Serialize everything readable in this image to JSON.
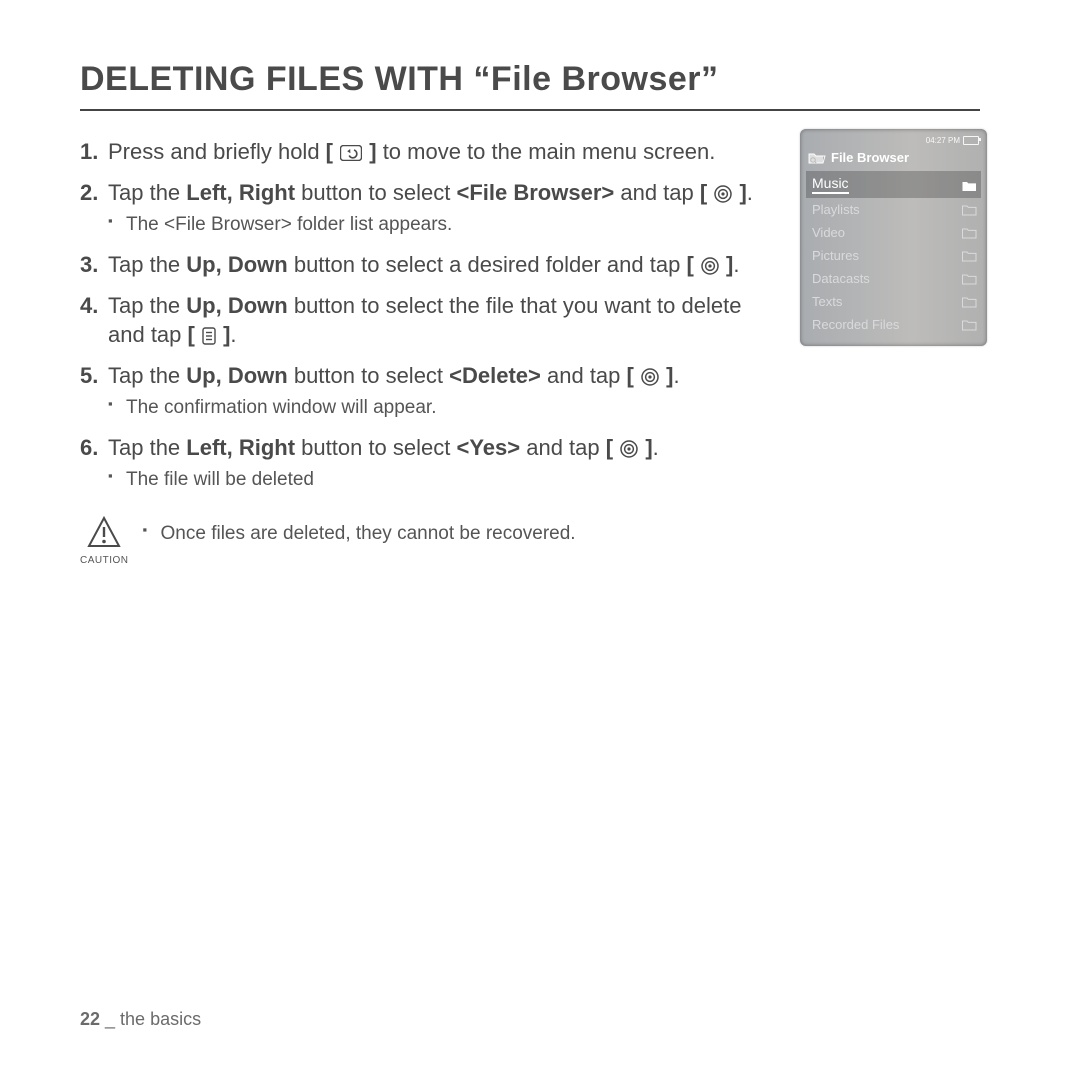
{
  "title": "DELETING FILES WITH “File Browser”",
  "steps": [
    {
      "pre": "Press and briefly hold ",
      "icon": "back",
      "post": " to move to the main menu screen."
    },
    {
      "pre": "Tap the ",
      "bold1": "Left, Right",
      "mid": " button to select ",
      "bold2": "<File Browser>",
      "post2": " and tap ",
      "icon": "select",
      "sub": [
        "The <File Browser> folder list appears."
      ]
    },
    {
      "pre": "Tap the ",
      "bold1": "Up, Down",
      "mid": " button to select a desired folder and tap ",
      "icon": "select"
    },
    {
      "pre": "Tap the ",
      "bold1": "Up, Down",
      "mid": " button to select the file that you want to delete and tap ",
      "icon": "menu"
    },
    {
      "pre": "Tap the ",
      "bold1": "Up, Down",
      "mid": " button to select ",
      "bold2": "<Delete>",
      "post2": " and tap ",
      "icon": "select",
      "sub": [
        "The confirmation window will appear."
      ]
    },
    {
      "pre": " Tap the ",
      "bold1": "Left, Right",
      "mid": " button to select ",
      "bold2": "<Yes>",
      "post2": " and tap ",
      "icon": "select",
      "sub": [
        "The file will be deleted"
      ]
    }
  ],
  "caution": {
    "label": "CAUTION",
    "text": "Once files are deleted, they cannot be recovered."
  },
  "footer": {
    "page": "22",
    "sep": " _ ",
    "section": "the basics"
  },
  "device": {
    "status_time": "04:27 PM",
    "title": "File Browser",
    "items": [
      {
        "label": "Music",
        "selected": true
      },
      {
        "label": "Playlists",
        "selected": false
      },
      {
        "label": "Video",
        "selected": false
      },
      {
        "label": "Pictures",
        "selected": false
      },
      {
        "label": "Datacasts",
        "selected": false
      },
      {
        "label": "Texts",
        "selected": false
      },
      {
        "label": "Recorded Files",
        "selected": false
      }
    ]
  }
}
